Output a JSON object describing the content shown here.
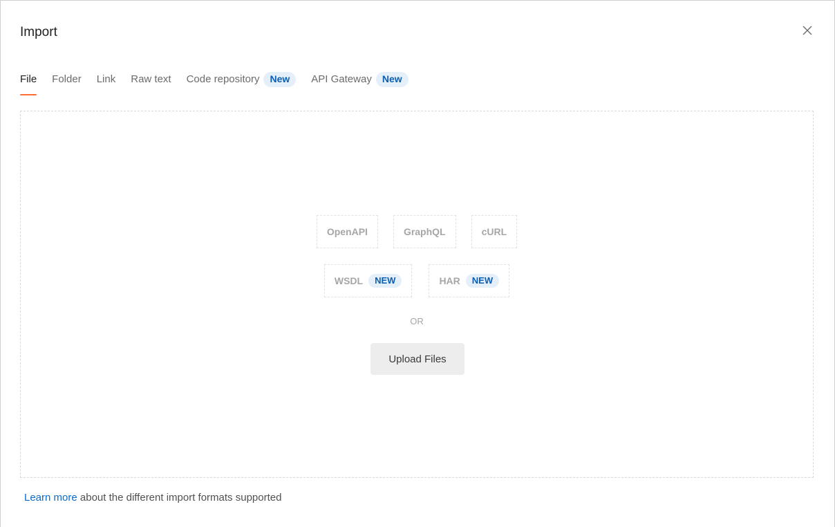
{
  "dialog": {
    "title": "Import",
    "close_icon": "close-icon"
  },
  "tabs": [
    {
      "label": "File",
      "active": true
    },
    {
      "label": "Folder"
    },
    {
      "label": "Link"
    },
    {
      "label": "Raw text"
    },
    {
      "label": "Code repository",
      "badge": "New"
    },
    {
      "label": "API Gateway",
      "badge": "New"
    }
  ],
  "dropzone": {
    "formats_row1": [
      "OpenAPI",
      "GraphQL",
      "cURL"
    ],
    "formats_row2": [
      {
        "label": "WSDL",
        "badge": "NEW"
      },
      {
        "label": "HAR",
        "badge": "NEW"
      }
    ],
    "separator": "OR",
    "upload_label": "Upload Files"
  },
  "footer": {
    "link_text": "Learn more",
    "text": " about the different import formats supported"
  },
  "colors": {
    "accent": "#ff6c37",
    "badge_bg": "#e5effa",
    "badge_text": "#0b5fb3",
    "link": "#0b6bcb"
  }
}
